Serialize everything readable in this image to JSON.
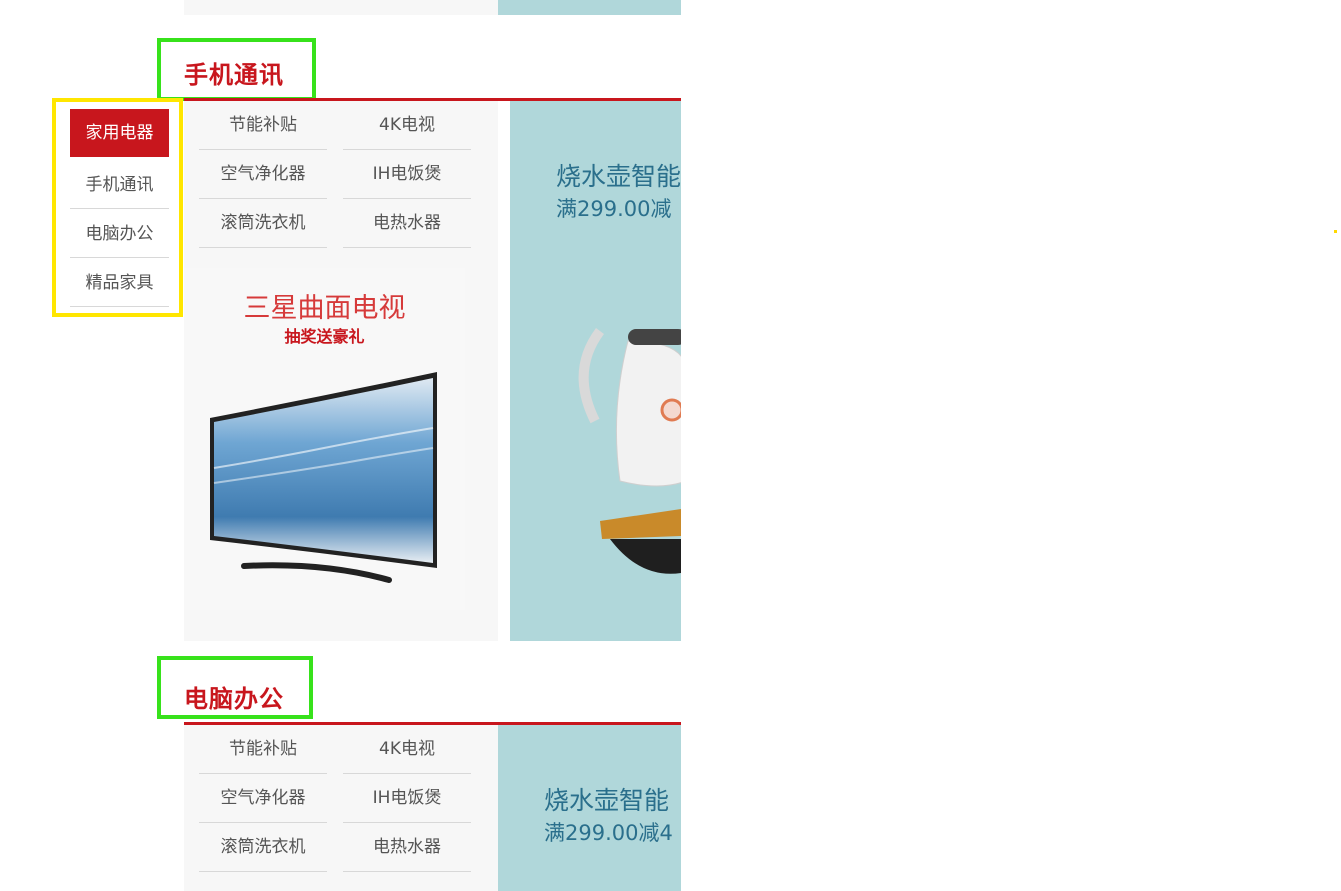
{
  "floors": [
    {
      "title": "手机通讯"
    },
    {
      "title": "电脑办公"
    }
  ],
  "side_nav": {
    "items": [
      {
        "label": "家用电器"
      },
      {
        "label": "手机通讯"
      },
      {
        "label": "电脑办公"
      },
      {
        "label": "精品家具"
      }
    ]
  },
  "categories": [
    {
      "label": "节能补贴"
    },
    {
      "label": "4K电视"
    },
    {
      "label": "空气净化器"
    },
    {
      "label": "IH电饭煲"
    },
    {
      "label": "滚筒洗衣机"
    },
    {
      "label": "电热水器"
    }
  ],
  "promo": {
    "line1": "烧水壶智能",
    "line2": "满299.00减",
    "line2_b": "满299.00减4"
  },
  "tv_ad": {
    "title": "三星曲面电视",
    "subtitle": "抽奖送豪礼"
  },
  "colors": {
    "accent": "#c8161d",
    "teal": "#b0d7da",
    "green_outline": "#37e21b",
    "yellow_outline": "#ffe600"
  }
}
